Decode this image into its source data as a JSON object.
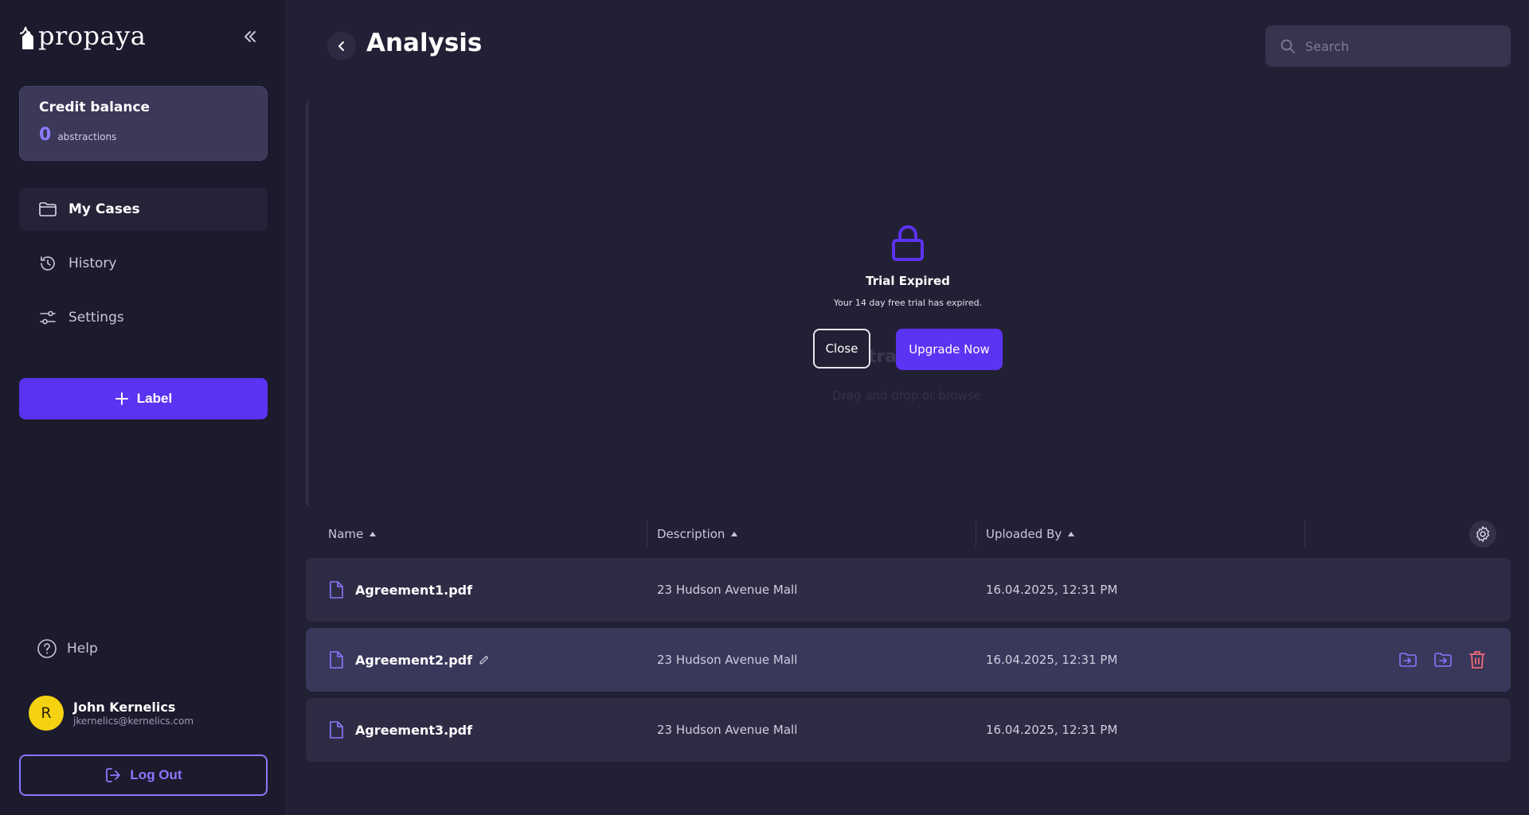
{
  "app": {
    "logo_text": "propaya"
  },
  "sidebar": {
    "credit": {
      "title": "Credit balance",
      "value": "0",
      "unit": "abstractions"
    },
    "nav": [
      {
        "label": "My Cases",
        "icon": "folder-icon",
        "active": true
      },
      {
        "label": "History",
        "icon": "history-icon",
        "active": false
      },
      {
        "label": "Settings",
        "icon": "sliders-icon",
        "active": false
      }
    ],
    "label_button": "Label",
    "help": "Help",
    "user": {
      "initial": "R",
      "name": "John Kernelics",
      "email": "jkernelics@kernelics.com"
    },
    "logout": "Log Out"
  },
  "header": {
    "title": "Analysis",
    "search_placeholder": "Search"
  },
  "upload": {
    "ghost_title": "tra",
    "ghost_hint": "Drag and drop or browse"
  },
  "modal": {
    "title": "Trial Expired",
    "message": "Your 14 day free trial has expired.",
    "close": "Close",
    "upgrade": "Upgrade Now"
  },
  "table": {
    "columns": [
      "Name",
      "Description",
      "Uploaded By"
    ],
    "rows": [
      {
        "name": "Agreement1.pdf",
        "description": "23 Hudson Avenue Mall",
        "uploaded": "16.04.2025, 12:31 PM"
      },
      {
        "name": "Agreement2.pdf",
        "description": "23 Hudson Avenue Mall",
        "uploaded": "16.04.2025, 12:31 PM"
      },
      {
        "name": "Agreement3.pdf",
        "description": "23 Hudson Avenue Mall",
        "uploaded": "16.04.2025, 12:31 PM"
      }
    ]
  },
  "colors": {
    "accent": "#5b33f2",
    "accent_light": "#8a77ff",
    "danger": "#f06a78"
  }
}
